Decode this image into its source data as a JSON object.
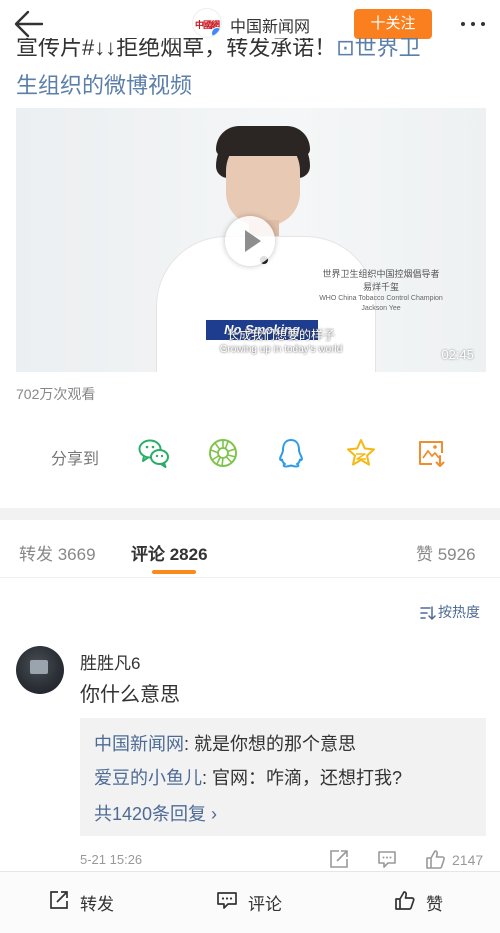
{
  "header": {
    "account_name": "中国新闻网",
    "avatar_text": "中國網",
    "follow_label": "十关注"
  },
  "post": {
    "line1": "宣传片#↓↓拒绝烟草，转发承诺！",
    "line1_link": "⊡世界卫",
    "line2_link": "生组织的微博视频"
  },
  "video": {
    "caption_cn_1": "世界卫生组织中国控烟倡导者",
    "caption_cn_2": "易烊千玺",
    "caption_en_1": "WHO China Tobacco Control Champion",
    "caption_en_2": "Jackson Yee",
    "shirt_text": "No Smoking",
    "subtitle_cn": "长成我们想要的样子",
    "subtitle_en": "Growing up in today's world",
    "duration": "02:45",
    "views": "702万次观看"
  },
  "share": {
    "label": "分享到",
    "targets": [
      "wechat-icon",
      "moments-icon",
      "qq-icon",
      "qzone-icon",
      "save-image-icon"
    ]
  },
  "tabs": {
    "repost": "转发 3669",
    "comments": "评论 2826",
    "likes": "赞 5926"
  },
  "sort_label": "按热度",
  "comment": {
    "user": "胜胜凡6",
    "text": "你什么意思",
    "replies": [
      {
        "who": "中国新闻网",
        "text": ": 就是你想的那个意思"
      },
      {
        "who": "爱豆的小鱼儿",
        "text": ": 官网：咋滴，还想打我?"
      }
    ],
    "more_replies": "共1420条回复 ›",
    "time": "5-21 15:26",
    "likes": "2147"
  },
  "bottom_bar": {
    "repost": "转发",
    "comment": "评论",
    "like": "赞"
  },
  "colors": {
    "follow_orange": "#f97f1f",
    "link_blue": "#4e6b95",
    "tab_indicator": "#f98a1b"
  }
}
